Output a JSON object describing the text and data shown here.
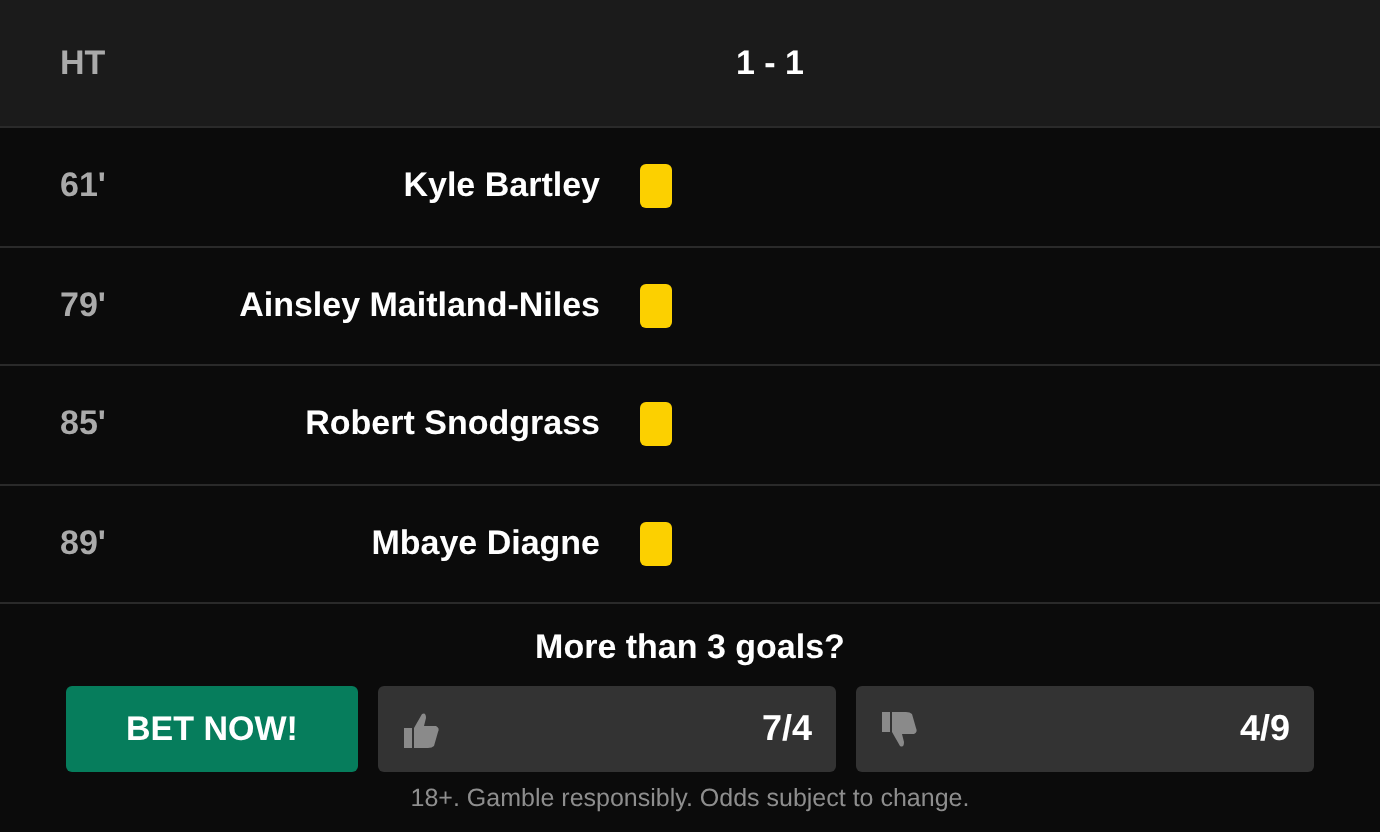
{
  "header": {
    "period": "HT",
    "score": "1 - 1"
  },
  "events": [
    {
      "minute": "61'",
      "player": "Kyle Bartley",
      "color": "#fcd000"
    },
    {
      "minute": "79'",
      "player": "Ainsley Maitland-Niles",
      "color": "#fcd000"
    },
    {
      "minute": "85'",
      "player": "Robert Snodgrass",
      "color": "#fcd000"
    },
    {
      "minute": "89'",
      "player": "Mbaye Diagne",
      "color": "#fcd000"
    }
  ],
  "bet": {
    "question": "More than 3 goals?",
    "button": "BET NOW!",
    "odds": [
      {
        "kind": "yes",
        "value": "7/4"
      },
      {
        "kind": "no",
        "value": "4/9"
      }
    ],
    "disclaimer": "18+. Gamble responsibly. Odds subject to change."
  }
}
